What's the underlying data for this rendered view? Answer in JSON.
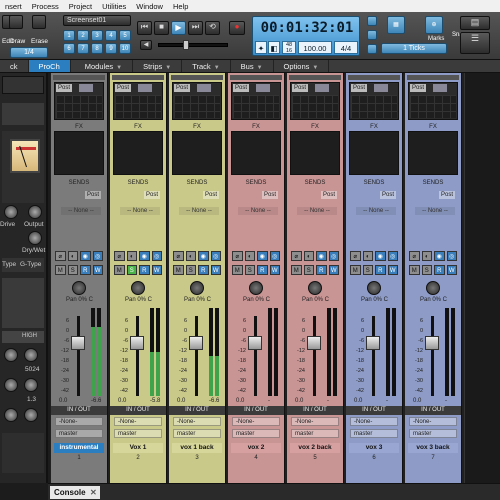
{
  "menubar": {
    "items": [
      "nsert",
      "Process",
      "Project",
      "Utilities",
      "Window",
      "Help"
    ]
  },
  "toolbar": {
    "screenset_label": "Screenset01",
    "screenset_numbers": [
      "1",
      "2",
      "3",
      "4",
      "5",
      "6",
      "7",
      "8",
      "9",
      "10"
    ],
    "left_labels": [
      "Edit",
      "Draw",
      "Erase"
    ],
    "left_fraction": "1/4",
    "time": "00:01:32:01",
    "tempo_top": "48",
    "tempo_bottom": "16",
    "bpm": "100.00",
    "meter": "4/4",
    "snap_label": "1 Ticks",
    "right_labels": [
      "Snap",
      "Marks"
    ]
  },
  "tabs": [
    {
      "label": "ck",
      "active": false
    },
    {
      "label": "ProCh",
      "active": true
    },
    {
      "label": "Modules",
      "active": false
    },
    {
      "label": "Strips",
      "active": false
    },
    {
      "label": "Track",
      "active": false
    },
    {
      "label": "Bus",
      "active": false
    },
    {
      "label": "Options",
      "active": false
    }
  ],
  "left_panel": {
    "labels": [
      "Drive",
      "Output",
      "Dry/Wet",
      "Type",
      "G-Type",
      "HIGH"
    ],
    "values": [
      "5024",
      "1.3"
    ]
  },
  "strip_common": {
    "post": "Post",
    "fx": "FX",
    "sends": "SENDS",
    "none": "-- None --",
    "btn_m": "M",
    "btn_s": "S",
    "btn_r": "R",
    "btn_w": "W",
    "pan": "Pan  0% C",
    "scale": [
      "6",
      "0",
      "-6",
      "-12",
      "-18",
      "-24",
      "-30",
      "-42"
    ],
    "inout": "IN / OUT",
    "input": "-None-",
    "output": "master"
  },
  "strips": [
    {
      "name": "instrumental",
      "num": "1",
      "color": "#7b7b7b",
      "name_bg": "#2b7fc0",
      "name_fg": "#ffffff",
      "vol": "0.0",
      "peak": "-6.6",
      "meter_level": 0.78
    },
    {
      "name": "Vox 1",
      "num": "2",
      "color": "#c9c98a",
      "name_bg": "#d6d69a",
      "name_fg": "#111111",
      "vol": "0.0",
      "peak": "-5.8",
      "meter_level": 0.5
    },
    {
      "name": "vox 1 back",
      "num": "3",
      "color": "#c9c98a",
      "name_bg": "#d6d69a",
      "name_fg": "#111111",
      "vol": "0.0",
      "peak": "-6.6",
      "meter_level": 0.45
    },
    {
      "name": "vox 2",
      "num": "4",
      "color": "#c99494",
      "name_bg": "#d6a0a0",
      "name_fg": "#111111",
      "vol": "0.0",
      "peak": "-",
      "meter_level": 0.0
    },
    {
      "name": "vox 2 back",
      "num": "5",
      "color": "#c99494",
      "name_bg": "#d6a0a0",
      "name_fg": "#111111",
      "vol": "0.0",
      "peak": "-",
      "meter_level": 0.0
    },
    {
      "name": "vox 3",
      "num": "6",
      "color": "#8d9bc6",
      "name_bg": "#98a6d1",
      "name_fg": "#111111",
      "vol": "0.0",
      "peak": "-",
      "meter_level": 0.0
    },
    {
      "name": "vox 3 back",
      "num": "7",
      "color": "#8d9bc6",
      "name_bg": "#98a6d1",
      "name_fg": "#111111",
      "vol": "0.0",
      "peak": "-",
      "meter_level": 0.0
    }
  ],
  "console": {
    "tab_label": "Console",
    "close": "✕"
  }
}
